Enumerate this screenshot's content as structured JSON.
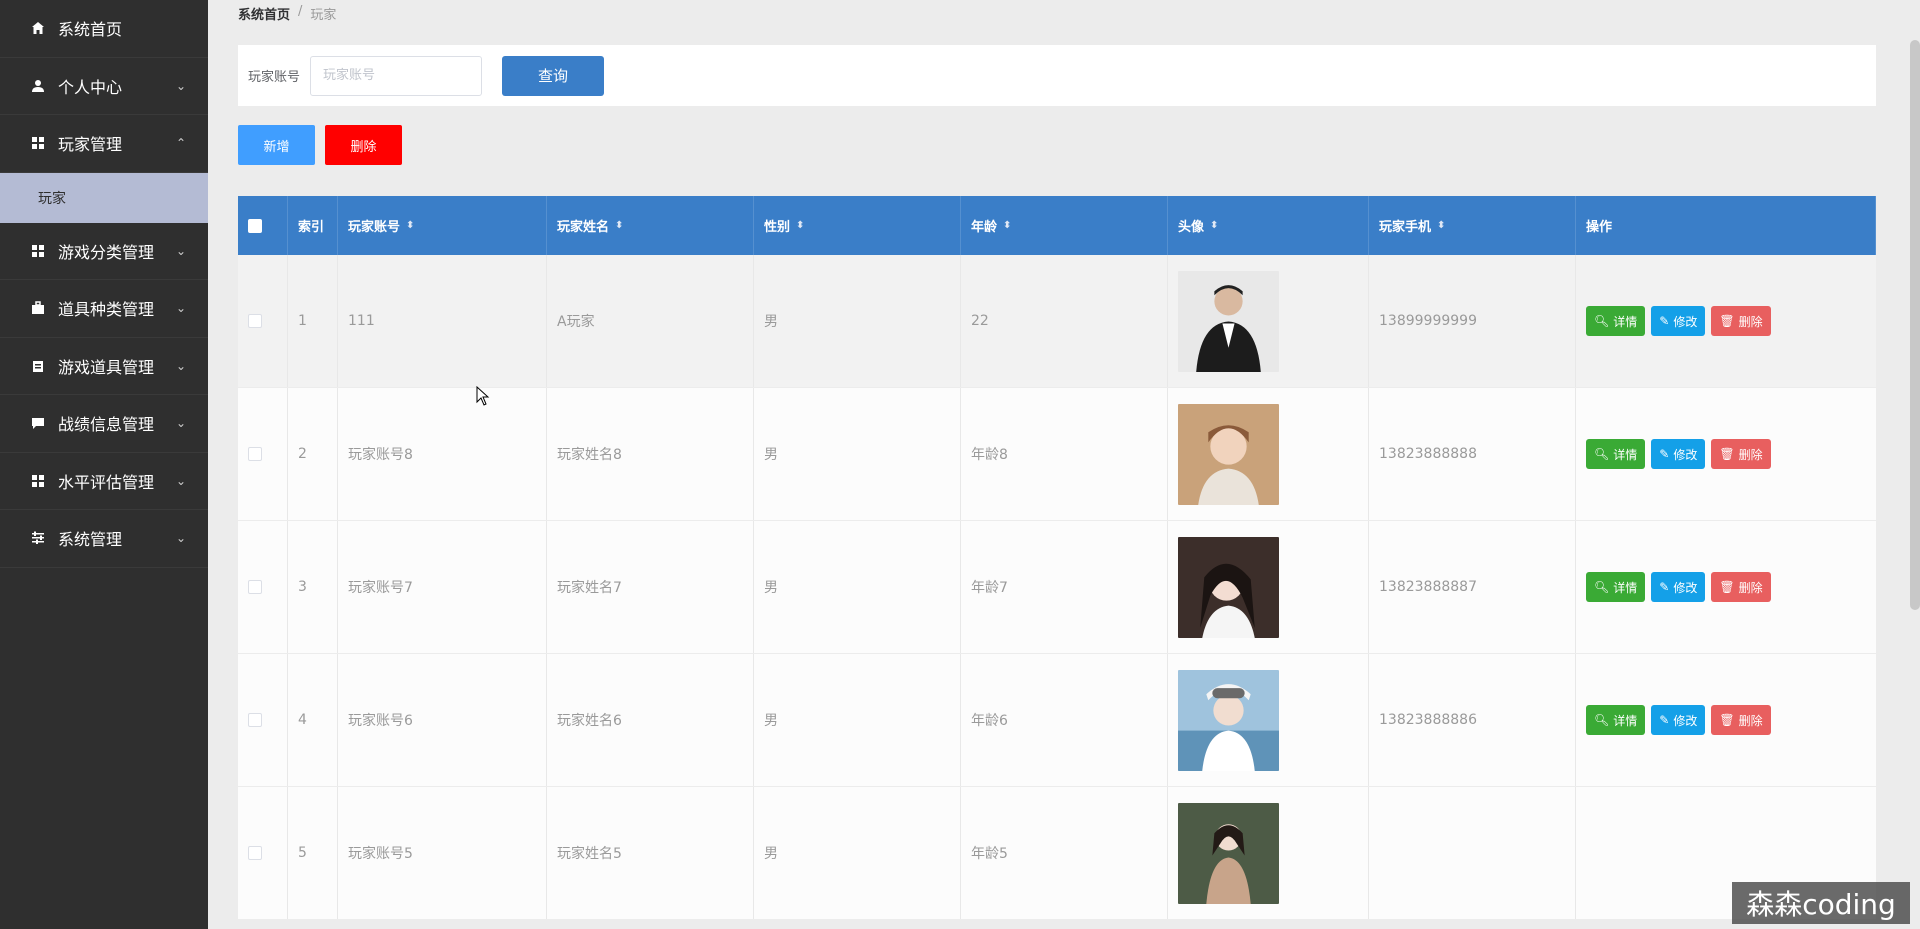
{
  "sidebar": {
    "items": [
      {
        "label": "系统首页",
        "icon": "home-icon",
        "arrow": ""
      },
      {
        "label": "个人中心",
        "icon": "user-icon",
        "arrow": "⌄"
      },
      {
        "label": "玩家管理",
        "icon": "grid-icon",
        "arrow": "⌃"
      },
      {
        "label": "游戏分类管理",
        "icon": "grid-icon",
        "arrow": "⌄"
      },
      {
        "label": "道具种类管理",
        "icon": "briefcase-icon",
        "arrow": "⌄"
      },
      {
        "label": "游戏道具管理",
        "icon": "clipboard-icon",
        "arrow": "⌄"
      },
      {
        "label": "战绩信息管理",
        "icon": "chat-icon",
        "arrow": "⌄"
      },
      {
        "label": "水平评估管理",
        "icon": "grid-icon",
        "arrow": "⌄"
      },
      {
        "label": "系统管理",
        "icon": "sliders-icon",
        "arrow": "⌄"
      }
    ],
    "submenu": {
      "label": "玩家"
    }
  },
  "breadcrumb": {
    "home": "系统首页",
    "separator": "/",
    "current": "玩家"
  },
  "search": {
    "label": "玩家账号",
    "placeholder": "玩家账号",
    "button": "查询"
  },
  "actions": {
    "add": "新增",
    "delete": "删除"
  },
  "table": {
    "headers": {
      "index": "索引",
      "account": "玩家账号",
      "name": "玩家姓名",
      "gender": "性别",
      "age": "年龄",
      "avatar": "头像",
      "phone": "玩家手机",
      "ops": "操作"
    },
    "op_labels": {
      "detail": "详情",
      "edit": "修改",
      "delete": "删除"
    },
    "rows": [
      {
        "index": "1",
        "account": "111",
        "name": "A玩家",
        "gender": "男",
        "age": "22",
        "phone": "13899999999"
      },
      {
        "index": "2",
        "account": "玩家账号8",
        "name": "玩家姓名8",
        "gender": "男",
        "age": "年龄8",
        "phone": "13823888888"
      },
      {
        "index": "3",
        "account": "玩家账号7",
        "name": "玩家姓名7",
        "gender": "男",
        "age": "年龄7",
        "phone": "13823888887"
      },
      {
        "index": "4",
        "account": "玩家账号6",
        "name": "玩家姓名6",
        "gender": "男",
        "age": "年龄6",
        "phone": "13823888886"
      },
      {
        "index": "5",
        "account": "玩家账号5",
        "name": "玩家姓名5",
        "gender": "男",
        "age": "年龄5",
        "phone": ""
      }
    ]
  },
  "watermark": "森森coding",
  "colors": {
    "sidebar_bg": "#2f2f2f",
    "header_blue": "#3a7ec8",
    "add_blue": "#409eff",
    "delete_red": "#ff0000",
    "detail_green": "#3aaa35",
    "edit_blue": "#14a0e8",
    "op_delete_red": "#e85f5f"
  }
}
